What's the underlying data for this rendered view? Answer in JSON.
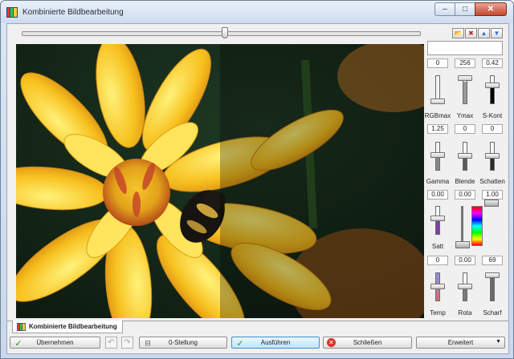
{
  "window": {
    "title": "Kombinierte Bildbearbeitung"
  },
  "window_controls": {
    "minimize": "–",
    "maximize": "□",
    "close": "✕"
  },
  "toolbar": {
    "tools": [
      {
        "name": "open-folder-icon",
        "glyph": "📂"
      },
      {
        "name": "delete-icon",
        "glyph": "✖",
        "color": "#d02020"
      },
      {
        "name": "arrow-up-icon",
        "glyph": "▲",
        "color": "#2f6fd0"
      },
      {
        "name": "arrow-down-icon",
        "glyph": "▼",
        "color": "#2f6fd0"
      }
    ],
    "preset_value": ""
  },
  "controls": {
    "row1": {
      "values": [
        "0",
        "256",
        "0.42"
      ],
      "labels": [
        "RGBmax",
        "Ymax",
        "S-Kont"
      ]
    },
    "row2": {
      "values": [
        "1.25",
        "0",
        "0"
      ],
      "labels": [
        "Gamma",
        "Blende",
        "Schatten"
      ]
    },
    "row3": {
      "values": [
        "0.00",
        "0.00",
        "1.00"
      ],
      "labels": [
        "Satt"
      ]
    },
    "row4": {
      "values": [
        "0",
        "0.00",
        "69"
      ],
      "labels": [
        "Temp",
        "Rota",
        "Scharf"
      ]
    }
  },
  "tab": {
    "label": "Kombinierte Bildbearbeitung"
  },
  "buttons": {
    "apply": "Übernehmen",
    "reset": "0-Stellung",
    "execute": "Ausführen",
    "close": "Schließen",
    "extended": "Erweitert",
    "undo": "↶",
    "redo": "↷"
  }
}
